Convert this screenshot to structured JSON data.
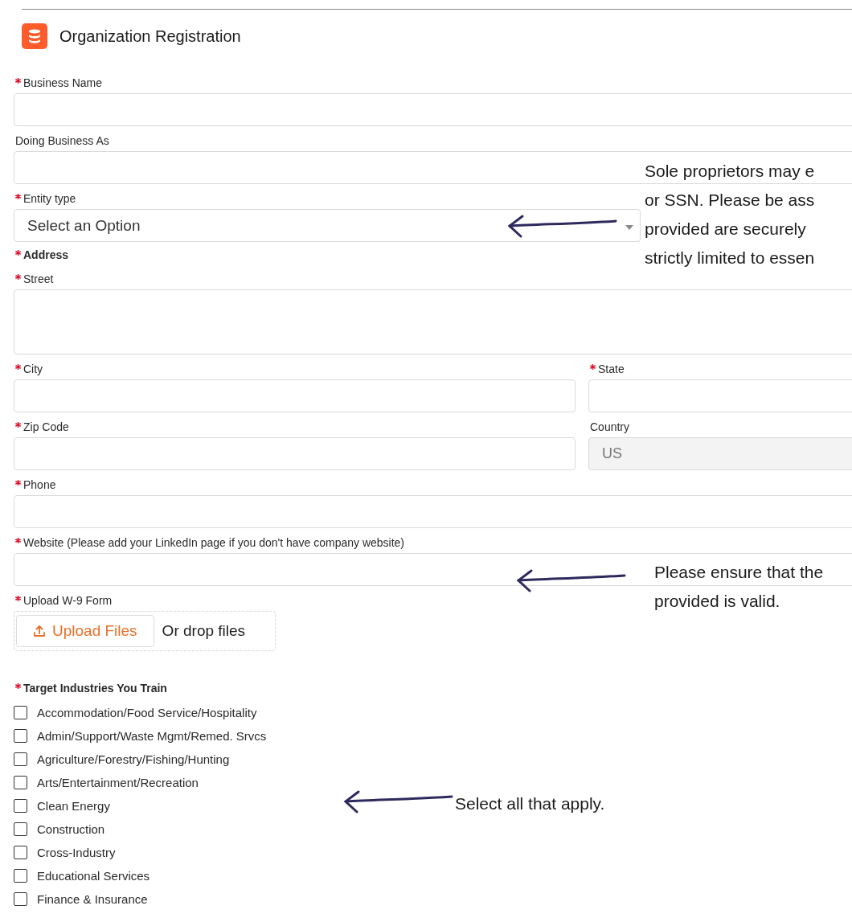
{
  "header": {
    "title": "Organization Registration"
  },
  "rows": [
    [
      {
        "kind": "text",
        "label": "Business Name",
        "required": true
      }
    ],
    [
      {
        "kind": "text",
        "label": "Doing Business As",
        "required": false
      }
    ],
    [
      {
        "kind": "select",
        "label": "Entity type",
        "required": true,
        "placeholder": "Select an Option"
      }
    ],
    [
      {
        "kind": "heading",
        "label": "Address",
        "required": true
      }
    ],
    [
      {
        "kind": "textarea",
        "label": "Street",
        "required": true
      }
    ],
    [
      {
        "kind": "text",
        "label": "City",
        "required": true
      },
      {
        "kind": "text",
        "label": "State",
        "required": true
      }
    ],
    [
      {
        "kind": "text",
        "label": "Zip Code",
        "required": true
      },
      {
        "kind": "text",
        "label": "Country",
        "required": false,
        "value": "US",
        "disabled": true
      }
    ],
    [
      {
        "kind": "text",
        "label": "Phone",
        "required": true
      }
    ],
    [
      {
        "kind": "text",
        "label": "Website (Please add your LinkedIn page if you don't have company website)",
        "required": true
      }
    ],
    [
      {
        "kind": "upload",
        "label": "Upload W-9 Form",
        "required": true,
        "button": "Upload Files",
        "hint": "Or drop files"
      }
    ]
  ],
  "industries": {
    "label": "Target Industries You Train",
    "required": true,
    "options": [
      {
        "label": "Accommodation/Food Service/Hospitality",
        "checked": false
      },
      {
        "label": "Admin/Support/Waste Mgmt/Remed. Srvcs",
        "checked": false
      },
      {
        "label": "Agriculture/Forestry/Fishing/Hunting",
        "checked": false
      },
      {
        "label": "Arts/Entertainment/Recreation",
        "checked": false
      },
      {
        "label": "Clean Energy",
        "checked": false
      },
      {
        "label": "Construction",
        "checked": false
      },
      {
        "label": "Cross-Industry",
        "checked": false
      },
      {
        "label": "Educational Services",
        "checked": false
      },
      {
        "label": "Finance & Insurance",
        "checked": false
      }
    ]
  },
  "annotations": [
    {
      "lines": [
        "Sole proprietors may e",
        "or SSN. Please be ass",
        "provided are securely",
        "strictly limited to essen"
      ]
    },
    {
      "lines": [
        "Please ensure that the",
        "provided is valid."
      ]
    },
    {
      "lines": [
        "Select all that apply."
      ]
    }
  ]
}
